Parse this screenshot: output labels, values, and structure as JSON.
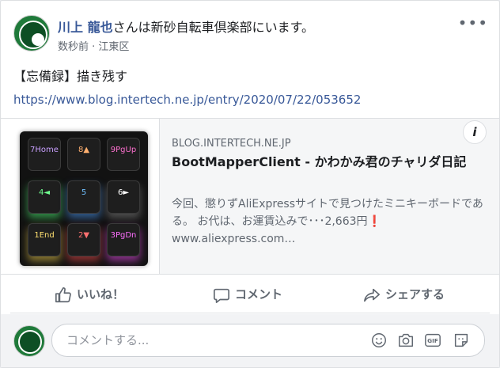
{
  "post": {
    "author_name": "川上 龍也",
    "author_suffix": "さんは新砂自転車倶楽部にいます。",
    "time": "数秒前",
    "separator": " · ",
    "location": "江東区",
    "more_label": "•••",
    "text": "【忘備録】描き残す",
    "url": "https://www.blog.intertech.ne.jp/entry/2020/07/22/053652"
  },
  "link_preview": {
    "domain": "BLOG.INTERTECH.NE.JP",
    "title": "BootMapperClient - かわかみ君のチャリダ日記",
    "description": "今回、懲りずAliExpressサイトで見つけたミニキーボードである。 お代は、お運賃込みで･･･2,663円❗ www.aliexpress.com…",
    "info_label": "i",
    "keys": [
      "7Home",
      "8▲",
      "9PgUp",
      "4◄",
      "5",
      "6►",
      "1End",
      "2▼",
      "3PgDn"
    ]
  },
  "actions": {
    "like": "いいね！",
    "comment": "コメント",
    "share": "シェアする"
  },
  "comment_box": {
    "placeholder": "コメントする..."
  },
  "icons": {
    "like": "thumbs-up-icon",
    "comment": "speech-bubble-icon",
    "share": "share-arrow-icon",
    "emoji": "smiley-icon",
    "camera": "camera-icon",
    "gif": "gif-icon",
    "sticker": "sticker-icon"
  },
  "colors": {
    "link": "#385898",
    "secondary": "#606770",
    "text": "#1c1e21"
  }
}
